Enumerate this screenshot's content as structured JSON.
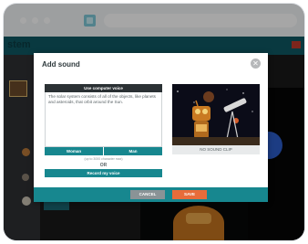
{
  "app": {
    "title": "stem"
  },
  "modal": {
    "title": "Add sound",
    "close_icon": "close-icon",
    "use_voice_label": "Use computer voice",
    "voice_text": "The solar system consists of all of the objects, like planets and asteroids, that orbit around the Sun.",
    "women_label": "Woman",
    "men_label": "Man",
    "char_hint": "(up to 3000 character max)",
    "or_label": "OR",
    "record_label": "Record my voice",
    "no_sound_label": "NO SOUND CLIP",
    "cancel_label": "CANCEL",
    "save_label": "SAVE"
  },
  "colors": {
    "teal": "#17878f",
    "dark_header": "#2b3134",
    "save_orange": "#e86c3a",
    "cancel_gray": "#8a9396"
  }
}
